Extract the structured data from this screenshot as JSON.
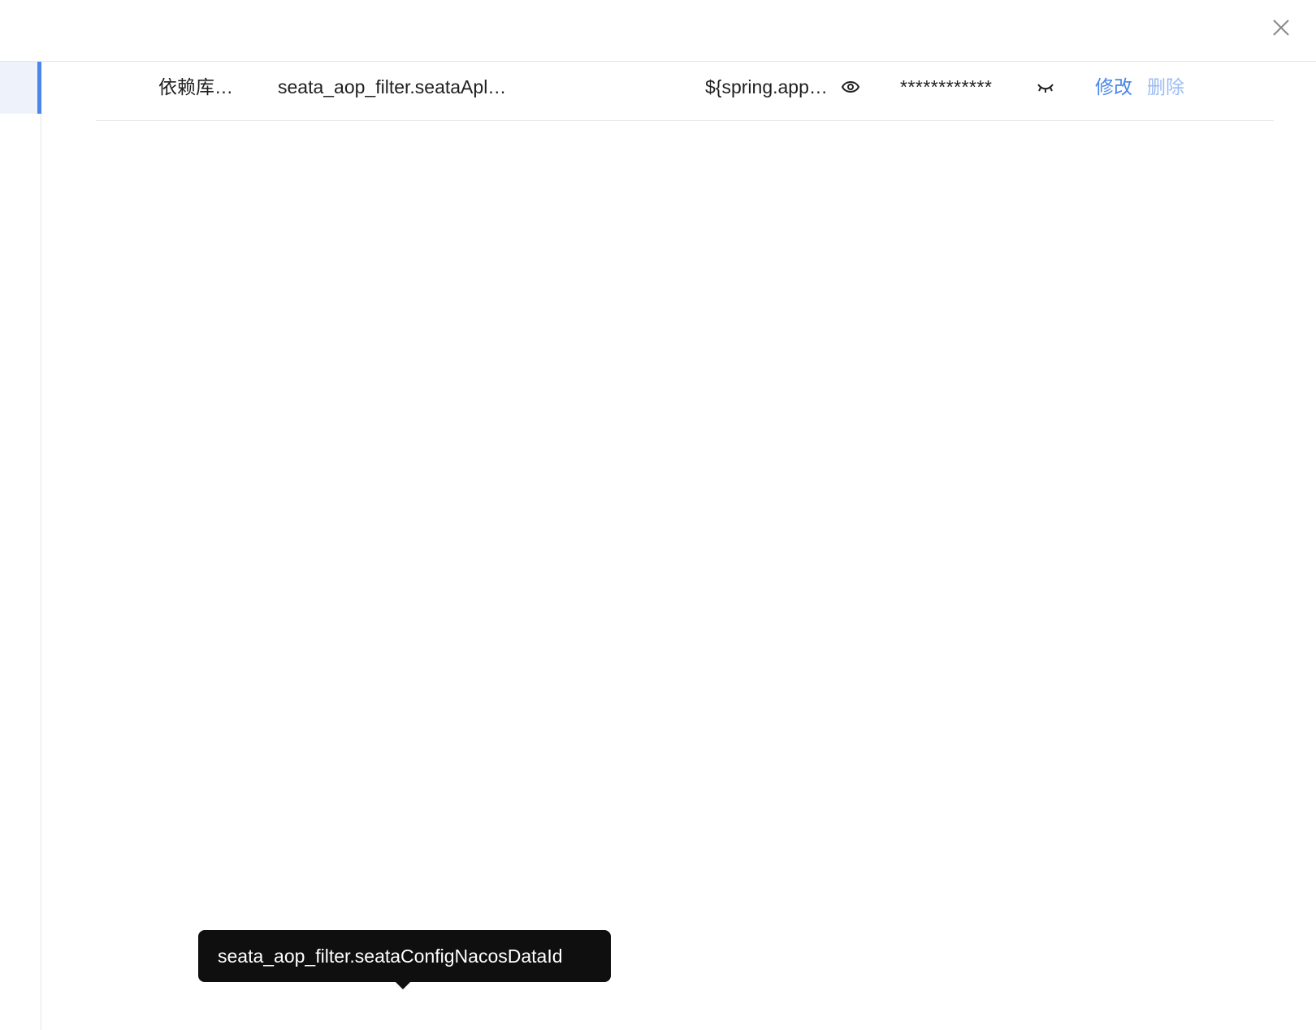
{
  "dialog": {
    "close_label": "×"
  },
  "table": {
    "action_edit": "修改",
    "action_delete": "删除",
    "rows": [
      {
        "name": "依赖库…",
        "key": "seata_aop_filter.seataApl…",
        "remark": "",
        "value": "${spring.app…",
        "encrypted": "************"
      }
    ]
  },
  "tooltip": {
    "text": "seata_aop_filter.seataConfigNacosDataId"
  }
}
